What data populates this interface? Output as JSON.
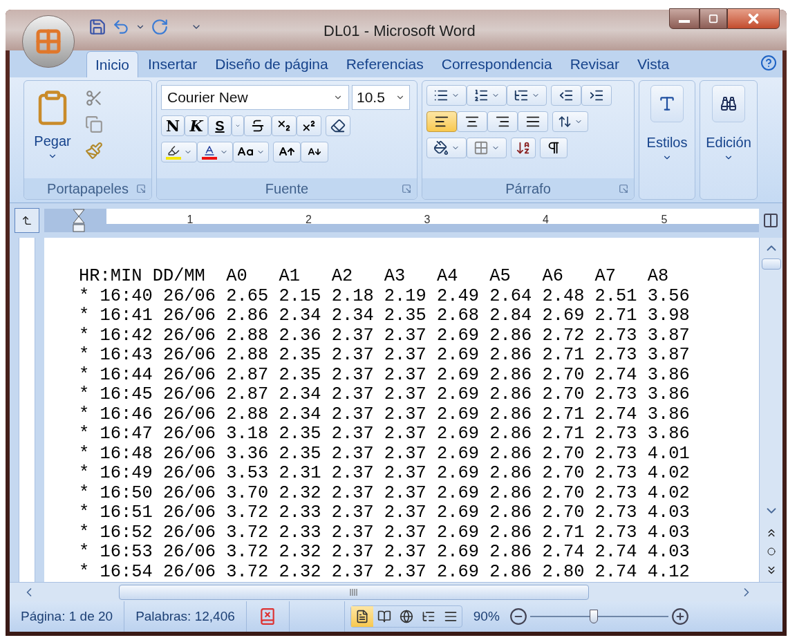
{
  "window": {
    "title": "DL01 - Microsoft Word"
  },
  "tabs": [
    {
      "label": "Inicio",
      "selected": true
    },
    {
      "label": "Insertar",
      "selected": false
    },
    {
      "label": "Diseño de página",
      "selected": false
    },
    {
      "label": "Referencias",
      "selected": false
    },
    {
      "label": "Correspondencia",
      "selected": false
    },
    {
      "label": "Revisar",
      "selected": false
    },
    {
      "label": "Vista",
      "selected": false
    }
  ],
  "ribbon": {
    "clipboard": {
      "paste_label": "Pegar",
      "group_label": "Portapapeles"
    },
    "font": {
      "font_name": "Courier New",
      "font_size": "10.5",
      "bold": "N",
      "italic": "K",
      "underline": "S",
      "group_label": "Fuente"
    },
    "paragraph": {
      "alignment": [
        {
          "kind": "left",
          "selected": true
        },
        {
          "kind": "center",
          "selected": false
        },
        {
          "kind": "right",
          "selected": false
        },
        {
          "kind": "justify",
          "selected": false
        }
      ],
      "group_label": "Párrafo"
    },
    "styles": {
      "label": "Estilos"
    },
    "editing": {
      "label": "Edición"
    }
  },
  "ruler": {
    "numbers": [
      "1",
      "2",
      "3",
      "4",
      "5"
    ]
  },
  "document": {
    "header": "HR:MIN DD/MM  A0   A1   A2   A3   A4   A5   A6   A7   A8",
    "rows": [
      "* 16:40 26/06 2.65 2.15 2.18 2.19 2.49 2.64 2.48 2.51 3.56",
      "* 16:41 26/06 2.86 2.34 2.34 2.35 2.68 2.84 2.69 2.71 3.98",
      "* 16:42 26/06 2.88 2.36 2.37 2.37 2.69 2.86 2.72 2.73 3.87",
      "* 16:43 26/06 2.88 2.35 2.37 2.37 2.69 2.86 2.71 2.73 3.87",
      "* 16:44 26/06 2.87 2.35 2.37 2.37 2.69 2.86 2.70 2.74 3.86",
      "* 16:45 26/06 2.87 2.34 2.37 2.37 2.69 2.86 2.70 2.73 3.86",
      "* 16:46 26/06 2.88 2.34 2.37 2.37 2.69 2.86 2.71 2.74 3.86",
      "* 16:47 26/06 3.18 2.35 2.37 2.37 2.69 2.86 2.71 2.73 3.86",
      "* 16:48 26/06 3.36 2.35 2.37 2.37 2.69 2.86 2.70 2.73 4.01",
      "* 16:49 26/06 3.53 2.31 2.37 2.37 2.69 2.86 2.70 2.73 4.02",
      "* 16:50 26/06 3.70 2.32 2.37 2.37 2.69 2.86 2.70 2.73 4.02",
      "* 16:51 26/06 3.72 2.33 2.37 2.37 2.69 2.86 2.70 2.73 4.03",
      "* 16:52 26/06 3.72 2.33 2.37 2.37 2.69 2.86 2.71 2.73 4.03",
      "* 16:53 26/06 3.72 2.32 2.37 2.37 2.69 2.86 2.74 2.74 4.03",
      "* 16:54 26/06 3.72 2.32 2.37 2.37 2.69 2.86 2.80 2.74 4.12"
    ]
  },
  "status_bar": {
    "page": "Página: 1 de 20",
    "words": "Palabras: 12,406",
    "views": [
      {
        "kind": "print",
        "selected": true
      },
      {
        "kind": "reading",
        "selected": false
      },
      {
        "kind": "web",
        "selected": false
      },
      {
        "kind": "outline",
        "selected": false
      },
      {
        "kind": "draft",
        "selected": false
      }
    ],
    "zoom": "90%",
    "zoom_slider": {
      "level": 0.46
    }
  }
}
